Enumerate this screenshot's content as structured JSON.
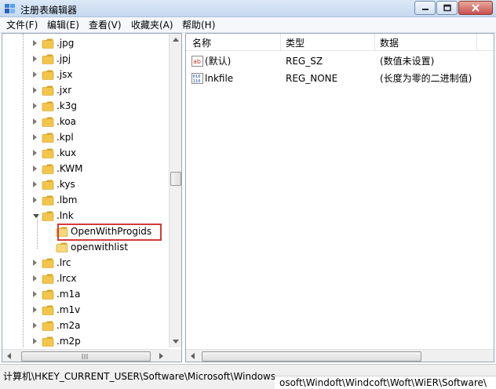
{
  "window": {
    "title": "注册表编辑器",
    "app_icon": "regedit-icon"
  },
  "menu": [
    {
      "label": "文件(F)"
    },
    {
      "label": "编辑(E)"
    },
    {
      "label": "查看(V)"
    },
    {
      "label": "收藏夹(A)"
    },
    {
      "label": "帮助(H)"
    }
  ],
  "tree": {
    "items": [
      {
        "label": ".jpg",
        "state": "collapsed",
        "level": 1
      },
      {
        "label": ".jpj",
        "state": "collapsed",
        "level": 1
      },
      {
        "label": ".jsx",
        "state": "collapsed",
        "level": 1
      },
      {
        "label": ".jxr",
        "state": "collapsed",
        "level": 1
      },
      {
        "label": ".k3g",
        "state": "collapsed",
        "level": 1
      },
      {
        "label": ".koa",
        "state": "collapsed",
        "level": 1
      },
      {
        "label": ".kpl",
        "state": "collapsed",
        "level": 1
      },
      {
        "label": ".kux",
        "state": "collapsed",
        "level": 1
      },
      {
        "label": ".KWM",
        "state": "collapsed",
        "level": 1
      },
      {
        "label": ".kys",
        "state": "collapsed",
        "level": 1
      },
      {
        "label": ".lbm",
        "state": "collapsed",
        "level": 1
      },
      {
        "label": ".lnk",
        "state": "expanded",
        "level": 1
      },
      {
        "label": "OpenWithProgids",
        "state": "leaf",
        "level": 2,
        "highlighted": true
      },
      {
        "label": "openwithlist",
        "state": "leaf",
        "level": 2
      },
      {
        "label": ".lrc",
        "state": "collapsed",
        "level": 1
      },
      {
        "label": ".lrcx",
        "state": "collapsed",
        "level": 1
      },
      {
        "label": ".m1a",
        "state": "collapsed",
        "level": 1
      },
      {
        "label": ".m1v",
        "state": "collapsed",
        "level": 1
      },
      {
        "label": ".m2a",
        "state": "collapsed",
        "level": 1
      },
      {
        "label": ".m2p",
        "state": "collapsed",
        "level": 1
      }
    ]
  },
  "list": {
    "columns": [
      "名称",
      "类型",
      "数据"
    ],
    "rows": [
      {
        "icon": "string-value-icon",
        "name": "(默认)",
        "type": "REG_SZ",
        "data": "(数值未设置)"
      },
      {
        "icon": "binary-value-icon",
        "name": "lnkfile",
        "type": "REG_NONE",
        "data": "(长度为零的二进制值)"
      }
    ]
  },
  "status": {
    "path": "计算机\\HKEY_CURRENT_USER\\Software\\Microsoft\\Windows",
    "overlay_text": "osoft\\Windoft\\Windcoft\\Woft\\WiER\\Software\\"
  }
}
